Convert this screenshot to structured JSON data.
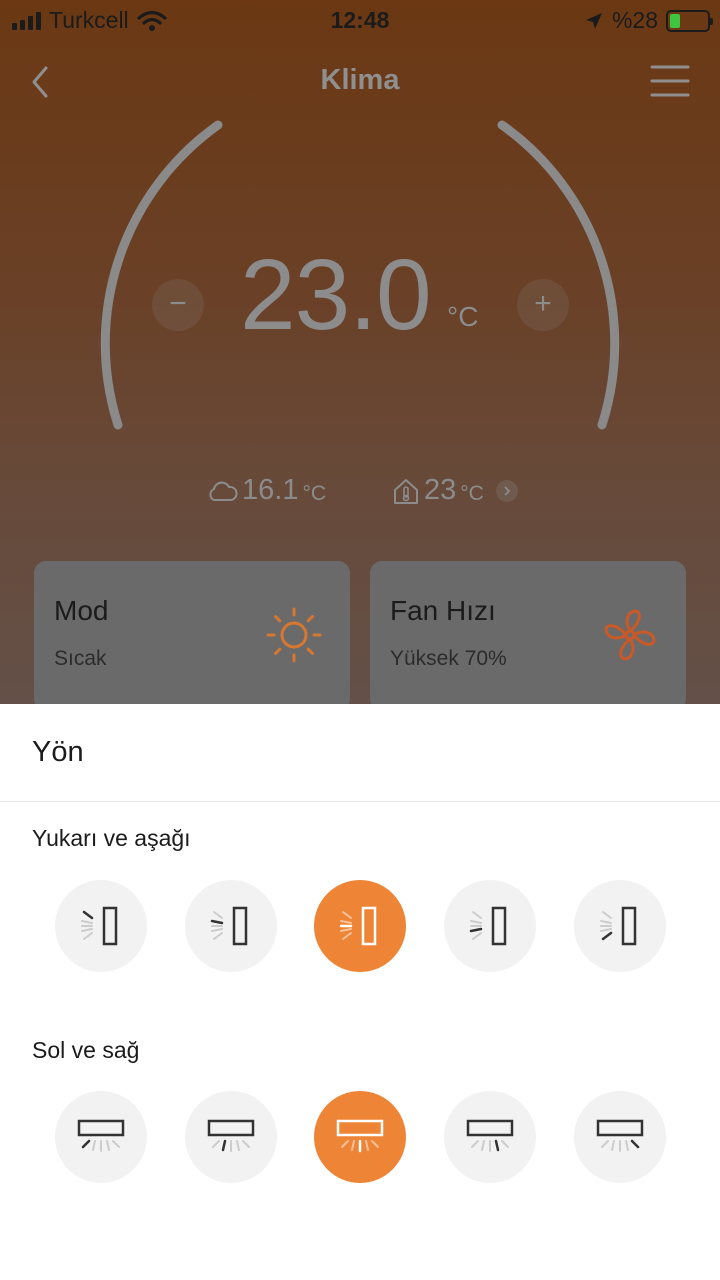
{
  "status_bar": {
    "carrier": "Turkcell",
    "time": "12:48",
    "battery": "%28",
    "battery_level": 0.28
  },
  "nav": {
    "title": "Klima",
    "back_icon": "chevron-left-icon",
    "menu_icon": "hamburger-menu-icon"
  },
  "thermostat": {
    "set_temp": "23.0",
    "unit": "°C",
    "decrease_label": "−",
    "increase_label": "+",
    "outdoor_temp": "16.1",
    "outdoor_unit": "°C",
    "indoor_temp": "23",
    "indoor_unit": "°C"
  },
  "cards": {
    "mode": {
      "title": "Mod",
      "value": "Sıcak",
      "icon": "sun-icon"
    },
    "fan": {
      "title": "Fan Hızı",
      "value": "Yüksek 70%",
      "icon": "fan-icon"
    }
  },
  "sheet": {
    "title": "Yön",
    "vertical_label": "Yukarı ve aşağı",
    "horizontal_label": "Sol ve sağ",
    "vertical_options": 5,
    "horizontal_options": 5,
    "vertical_selected_index": 2,
    "horizontal_selected_index": 2
  },
  "colors": {
    "accent": "#ee8435",
    "inactive_button": "#f2f2f2",
    "icon_gray": "#333333"
  }
}
